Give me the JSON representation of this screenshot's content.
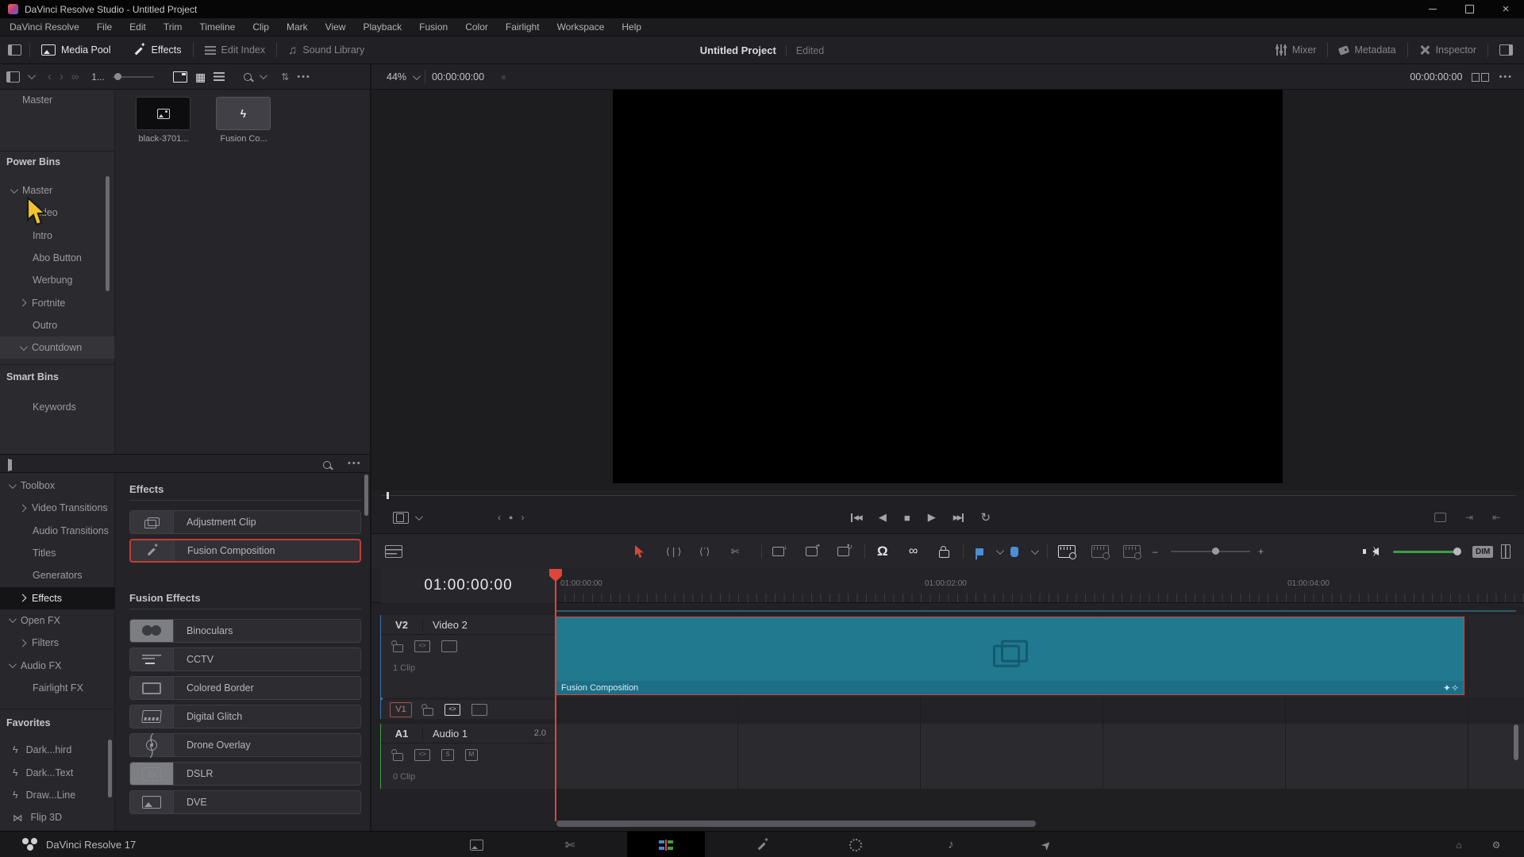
{
  "window": {
    "title": "DaVinci Resolve Studio - Untitled Project"
  },
  "menu_bar": [
    "DaVinci Resolve",
    "File",
    "Edit",
    "Trim",
    "Timeline",
    "Clip",
    "Mark",
    "View",
    "Playback",
    "Fusion",
    "Color",
    "Fairlight",
    "Workspace",
    "Help"
  ],
  "top_toolbar": {
    "media_pool": "Media Pool",
    "effects": "Effects",
    "edit_index": "Edit Index",
    "sound_library": "Sound Library",
    "project_title": "Untitled Project",
    "project_status": "Edited",
    "mixer": "Mixer",
    "metadata": "Metadata",
    "inspector": "Inspector"
  },
  "media_pool": {
    "zoom_label": "1...",
    "root_bin": "Master",
    "power_bins_header": "Power Bins",
    "smart_bins_header": "Smart Bins",
    "bins": [
      {
        "label": "Master",
        "chevron": "down",
        "indent": 0
      },
      {
        "label": "Video",
        "indent": 1
      },
      {
        "label": "Intro",
        "indent": 1
      },
      {
        "label": "Abo Button",
        "indent": 1
      },
      {
        "label": "Werbung",
        "indent": 1
      },
      {
        "label": "Fortnite",
        "chevron": "right",
        "indent": 1
      },
      {
        "label": "Outro",
        "indent": 1
      },
      {
        "label": "Countdown",
        "chevron": "down",
        "indent": 1,
        "highlighted": true
      }
    ],
    "smart_bins": [
      {
        "label": "Keywords"
      }
    ],
    "clips": [
      {
        "label": "black-3701...",
        "thumb": "dark",
        "icon": "image-icon"
      },
      {
        "label": "Fusion Co...",
        "thumb": "gray",
        "icon": "bolt-icon"
      }
    ]
  },
  "effects_library": {
    "tree": [
      {
        "label": "Toolbox",
        "chevron": "down",
        "indent": 0
      },
      {
        "label": "Video Transitions",
        "chevron": "right",
        "indent": 1
      },
      {
        "label": "Audio Transitions",
        "indent": 1
      },
      {
        "label": "Titles",
        "indent": 1
      },
      {
        "label": "Generators",
        "indent": 1
      },
      {
        "label": "Effects",
        "chevron": "right",
        "indent": 1,
        "selected": true
      },
      {
        "label": "Open FX",
        "chevron": "down",
        "indent": 0
      },
      {
        "label": "Filters",
        "chevron": "right",
        "indent": 1
      },
      {
        "label": "Audio FX",
        "chevron": "down",
        "indent": 0
      },
      {
        "label": "Fairlight FX",
        "indent": 1
      }
    ],
    "favorites_header": "Favorites",
    "favorites": [
      {
        "label": "Dark...hird",
        "icon": "bolt-icon"
      },
      {
        "label": "Dark...Text",
        "icon": "bolt-icon"
      },
      {
        "label": "Draw...Line",
        "icon": "bolt-icon"
      },
      {
        "label": "Flip 3D",
        "icon": "flip-icon"
      }
    ],
    "groups": [
      {
        "header": "Effects",
        "items": [
          {
            "label": "Adjustment Clip",
            "icon": "adjustment-clip-icon"
          },
          {
            "label": "Fusion Composition",
            "icon": "wand-icon",
            "selected": true
          }
        ]
      },
      {
        "header": "Fusion Effects",
        "items": [
          {
            "label": "Binoculars",
            "icon": "binoculars-icon"
          },
          {
            "label": "CCTV",
            "icon": "cctv-icon"
          },
          {
            "label": "Colored Border",
            "icon": "colored-border-icon"
          },
          {
            "label": "Digital Glitch",
            "icon": "digital-glitch-icon"
          },
          {
            "label": "Drone Overlay",
            "icon": "drone-overlay-icon"
          },
          {
            "label": "DSLR",
            "icon": "dslr-icon"
          },
          {
            "label": "DVE",
            "icon": "dve-icon"
          }
        ]
      }
    ]
  },
  "viewer": {
    "zoom_level": "44%",
    "timecode": "00:00:00:00",
    "duration_timecode": "00:00:00:00"
  },
  "timeline": {
    "playhead_timecode": "01:00:00:00",
    "ruler_labels": [
      "01:00:00:00",
      "01:00:02:00",
      "01:00:04:00"
    ],
    "tracks": {
      "v2": {
        "id": "V2",
        "name": "Video 2",
        "clip_count": "1 Clip"
      },
      "v1": {
        "id": "V1"
      },
      "a1": {
        "id": "A1",
        "name": "Audio 1",
        "channels": "2.0",
        "clip_count": "0 Clip",
        "solo_label": "S",
        "mute_label": "M"
      }
    },
    "clip": {
      "label": "Fusion Composition"
    },
    "dim_button": "DIM"
  },
  "footer": {
    "app_version": "DaVinci Resolve 17",
    "pages": [
      "Media",
      "Cut",
      "Edit",
      "Fusion",
      "Color",
      "Fairlight",
      "Deliver"
    ],
    "active_page": "Edit"
  },
  "colors": {
    "selection_red": "#cf4840",
    "clip_teal": "#21798f",
    "marker_blue": "#4a8fd3",
    "volume_green": "#3f9e45",
    "cursor_yellow": "#f2c230",
    "track_video_blue": "#3a76a8",
    "track_audio_green": "#3f9e45"
  }
}
